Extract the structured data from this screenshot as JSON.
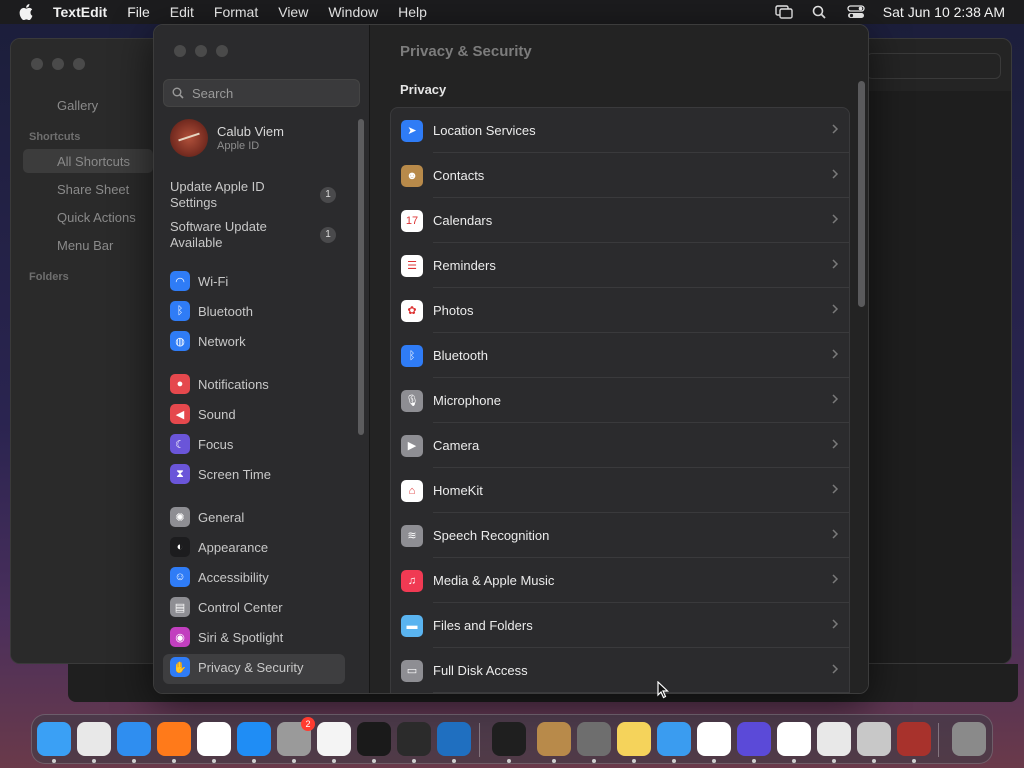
{
  "menubar": {
    "app_name": "TextEdit",
    "menus": [
      "File",
      "Edit",
      "Format",
      "View",
      "Window",
      "Help"
    ],
    "clock": "Sat Jun 10  2:38 AM"
  },
  "shortcuts_window": {
    "sidebar": {
      "gallery": "Gallery",
      "shortcuts_header": "Shortcuts",
      "items": [
        "All Shortcuts",
        "Share Sheet",
        "Quick Actions",
        "Menu Bar"
      ],
      "folders_header": "Folders"
    }
  },
  "settings": {
    "search_placeholder": "Search",
    "account": {
      "name": "Calub Viem",
      "subtitle": "Apple ID"
    },
    "updates": [
      {
        "label": "Update Apple ID Settings",
        "count": "1"
      },
      {
        "label": "Software Update Available",
        "count": "1"
      }
    ],
    "sidebar_groups": [
      [
        {
          "label": "Wi-Fi",
          "icon": "wifi-icon",
          "color": "#2f7cf6"
        },
        {
          "label": "Bluetooth",
          "icon": "bluetooth-icon",
          "color": "#2f7cf6"
        },
        {
          "label": "Network",
          "icon": "globe-icon",
          "color": "#2f7cf6"
        }
      ],
      [
        {
          "label": "Notifications",
          "icon": "bell-icon",
          "color": "#e5484d"
        },
        {
          "label": "Sound",
          "icon": "speaker-icon",
          "color": "#e5484d"
        },
        {
          "label": "Focus",
          "icon": "moon-icon",
          "color": "#6a55d9"
        },
        {
          "label": "Screen Time",
          "icon": "hourglass-icon",
          "color": "#6a55d9"
        }
      ],
      [
        {
          "label": "General",
          "icon": "gear-icon",
          "color": "#8e8e93"
        },
        {
          "label": "Appearance",
          "icon": "appearance-icon",
          "color": "#1c1c1e"
        },
        {
          "label": "Accessibility",
          "icon": "accessibility-icon",
          "color": "#2f7cf6"
        },
        {
          "label": "Control Center",
          "icon": "control-center-icon",
          "color": "#8e8e93"
        },
        {
          "label": "Siri & Spotlight",
          "icon": "siri-icon",
          "color": "#c23fbf"
        },
        {
          "label": "Privacy & Security",
          "icon": "hand-icon",
          "color": "#2f7cf6"
        }
      ]
    ],
    "content": {
      "title": "Privacy & Security",
      "section": "Privacy",
      "rows": [
        {
          "label": "Location Services",
          "icon": "location-arrow-icon",
          "color": "#2f7cf6"
        },
        {
          "label": "Contacts",
          "icon": "contacts-icon",
          "color": "#b88a4a"
        },
        {
          "label": "Calendars",
          "icon": "calendar-icon",
          "color": "#ffffff"
        },
        {
          "label": "Reminders",
          "icon": "reminders-icon",
          "color": "#ffffff"
        },
        {
          "label": "Photos",
          "icon": "photos-icon",
          "color": "#ffffff"
        },
        {
          "label": "Bluetooth",
          "icon": "bluetooth-icon",
          "color": "#2f7cf6"
        },
        {
          "label": "Microphone",
          "icon": "microphone-icon",
          "color": "#8e8e93"
        },
        {
          "label": "Camera",
          "icon": "camera-icon",
          "color": "#8e8e93"
        },
        {
          "label": "HomeKit",
          "icon": "home-icon",
          "color": "#ffffff"
        },
        {
          "label": "Speech Recognition",
          "icon": "waveform-icon",
          "color": "#8e8e93"
        },
        {
          "label": "Media & Apple Music",
          "icon": "music-note-icon",
          "color": "#f03a53"
        },
        {
          "label": "Files and Folders",
          "icon": "folder-icon",
          "color": "#5ab4f0"
        },
        {
          "label": "Full Disk Access",
          "icon": "disk-icon",
          "color": "#8e8e93"
        }
      ]
    }
  },
  "dock": {
    "apps": [
      {
        "name": "finder-icon",
        "color": "#3aa0f5"
      },
      {
        "name": "launchpad-icon",
        "color": "#e8e8e8"
      },
      {
        "name": "safari-icon",
        "color": "#2f8ef0"
      },
      {
        "name": "firefox-icon",
        "color": "#ff7a1a"
      },
      {
        "name": "chrome-icon",
        "color": "#ffffff"
      },
      {
        "name": "app-store-icon",
        "color": "#1f8df5"
      },
      {
        "name": "system-settings-icon",
        "color": "#9a9a9a",
        "badge": "2"
      },
      {
        "name": "textedit-icon",
        "color": "#f4f4f4"
      },
      {
        "name": "terminal-icon",
        "color": "#1a1a1a"
      },
      {
        "name": "garageband-icon",
        "color": "#2b2b2b"
      },
      {
        "name": "vscode-icon",
        "color": "#1f6fc0"
      },
      {
        "name": "activity-monitor-icon",
        "color": "#1f1f1f"
      },
      {
        "name": "contacts-dock-icon",
        "color": "#b88a4a"
      },
      {
        "name": "screenshot-icon",
        "color": "#6e6e6e"
      },
      {
        "name": "notes-icon",
        "color": "#f5d35b"
      },
      {
        "name": "weather-icon",
        "color": "#3a9cf0"
      },
      {
        "name": "reminders-dock-icon",
        "color": "#ffffff"
      },
      {
        "name": "shortcuts-icon",
        "color": "#5b4ad8"
      },
      {
        "name": "news-icon",
        "color": "#ffffff"
      },
      {
        "name": "font-book-icon",
        "color": "#e8e8e8"
      },
      {
        "name": "chess-icon",
        "color": "#c8c8c8"
      },
      {
        "name": "dictionary-icon",
        "color": "#a8322c"
      },
      {
        "name": "trash-icon",
        "color": "#8a8a8a"
      }
    ]
  }
}
